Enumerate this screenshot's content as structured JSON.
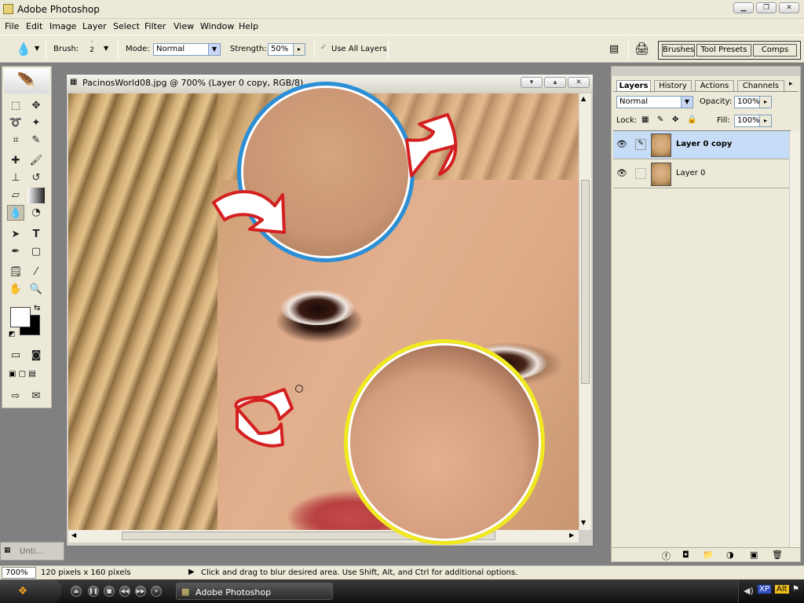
{
  "window": {
    "title": "Adobe Photoshop"
  },
  "menu": [
    "File",
    "Edit",
    "Image",
    "Layer",
    "Select",
    "Filter",
    "View",
    "Window",
    "Help"
  ],
  "options": {
    "brush_label": "Brush:",
    "brush_size": "2",
    "mode_label": "Mode:",
    "mode_value": "Normal",
    "strength_label": "Strength:",
    "strength_value": "50%",
    "use_all_layers": "Use All Layers",
    "well_tabs": [
      "Brushes",
      "Tool Presets",
      "Comps"
    ]
  },
  "document": {
    "title": "PacinosWorld08.jpg @ 700% (Layer 0 copy, RGB/8)"
  },
  "minimized_doc": {
    "label": "Unti..."
  },
  "layers_panel": {
    "tabs": [
      "Layers",
      "History",
      "Actions",
      "Channels"
    ],
    "blend_mode": "Normal",
    "opacity_label": "Opacity:",
    "opacity_value": "100%",
    "lock_label": "Lock:",
    "fill_label": "Fill:",
    "fill_value": "100%",
    "layers": [
      {
        "name": "Layer 0 copy",
        "selected": true
      },
      {
        "name": "Layer 0",
        "selected": false
      }
    ]
  },
  "status": {
    "zoom": "700%",
    "doc_size": "120 pixels x 160 pixels",
    "hint": "Click and drag to blur desired area.  Use Shift, Alt, and Ctrl for additional options."
  },
  "taskbar": {
    "task_label": "Adobe Photoshop"
  },
  "colors": {
    "highlight_blue": "#2a8fd6",
    "highlight_yellow": "#f0e820",
    "arrow_red": "#d42020"
  }
}
